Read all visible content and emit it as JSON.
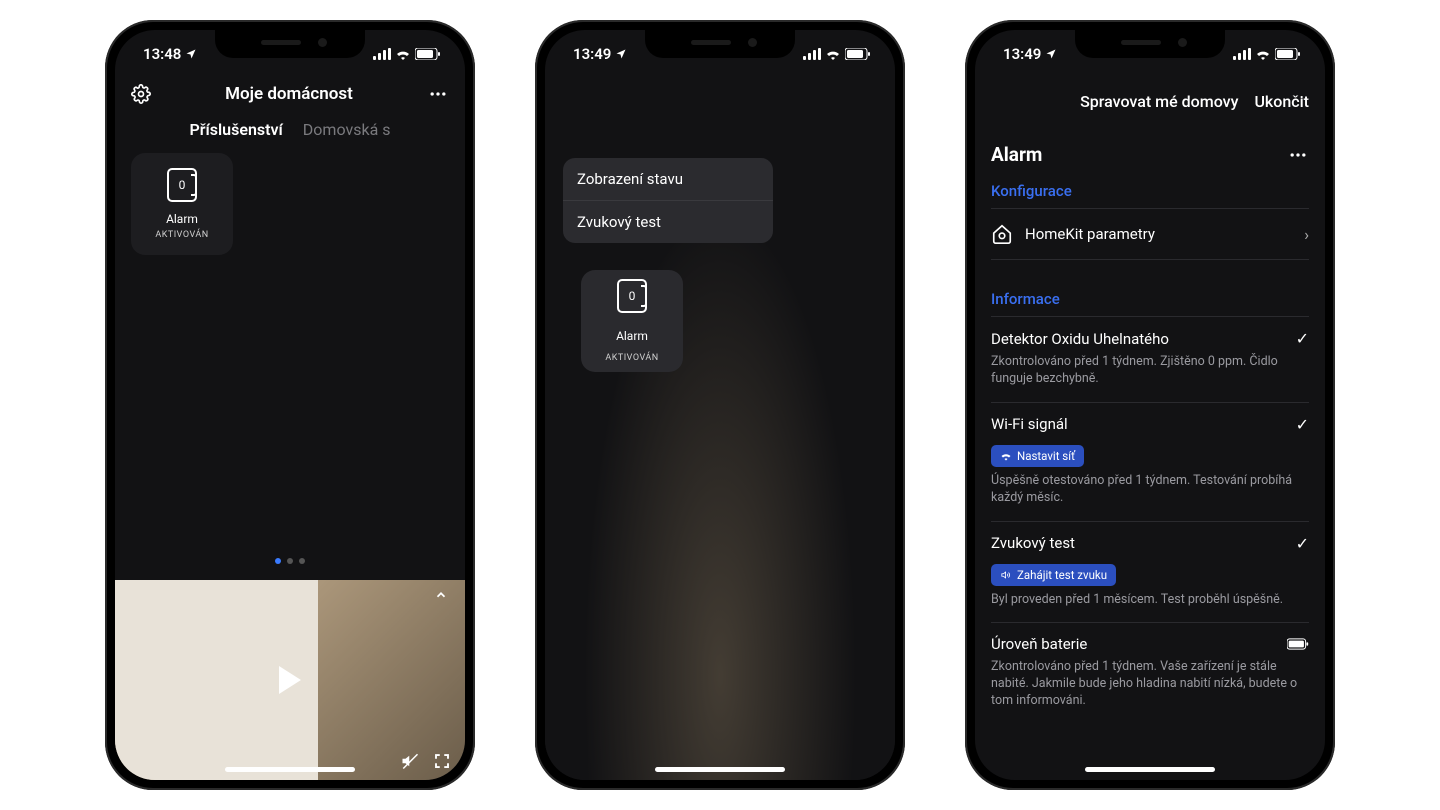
{
  "status": {
    "time1": "13:48",
    "time2": "13:49",
    "time3": "13:49"
  },
  "s1": {
    "title": "Moje domácnost",
    "tab_active": "Příslušenství",
    "tab_inactive": "Domovská s",
    "tile_label": "Alarm",
    "tile_status": "AKTIVOVÁN"
  },
  "s2": {
    "tile_label": "Alarm",
    "tile_status": "AKTIVOVÁN",
    "menu": {
      "item1": "Zobrazení stavu",
      "item2": "Zvukový test"
    }
  },
  "s3": {
    "nav_manage": "Spravovat mé domovy",
    "nav_done": "Ukončit",
    "title": "Alarm",
    "section_config": "Konfigurace",
    "row_homekit": "HomeKit parametry",
    "section_info": "Informace",
    "co": {
      "title": "Detektor Oxidu Uhelnatého",
      "desc": "Zkontrolováno před 1 týdnem. Zjištěno 0 ppm. Čidlo funguje bezchybně."
    },
    "wifi": {
      "title": "Wi-Fi signál",
      "chip": "Nastavit síť",
      "desc": "Úspěšně otestováno před 1 týdnem. Testování probíhá každý měsíc."
    },
    "sound": {
      "title": "Zvukový test",
      "chip": "Zahájit test zvuku",
      "desc": "Byl proveden před 1 měsícem. Test proběhl úspěšně."
    },
    "battery": {
      "title": "Úroveň baterie",
      "desc": "Zkontrolováno před 1 týdnem. Vaše zařízení je stále nabité. Jakmile bude jeho hladina nabití nízká, budete o tom informováni."
    }
  }
}
